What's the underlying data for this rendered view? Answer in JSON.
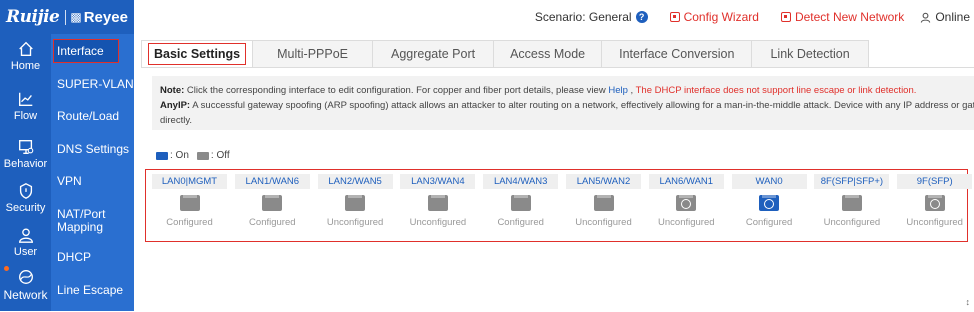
{
  "brand": {
    "name": "Ruijie",
    "product": "Reyee"
  },
  "header": {
    "scenario_label": "Scenario: General",
    "config_wizard": "Config Wizard",
    "detect_network": "Detect New Network",
    "online": "Online",
    "colors": {
      "primary": "#1e5fbd",
      "alert": "#e0302b"
    }
  },
  "rail": [
    {
      "label": "Home",
      "icon": "home-icon"
    },
    {
      "label": "Flow",
      "icon": "chart-icon"
    },
    {
      "label": "Behavior",
      "icon": "monitor-icon"
    },
    {
      "label": "Security",
      "icon": "shield-icon"
    },
    {
      "label": "User",
      "icon": "user-icon"
    },
    {
      "label": "Network",
      "icon": "globe-icon",
      "active": true
    }
  ],
  "submenu": [
    {
      "label": "Interface",
      "active": true
    },
    {
      "label": "SUPER-VLAN"
    },
    {
      "label": "Route/Load"
    },
    {
      "label": "DNS Settings"
    },
    {
      "label": "VPN"
    },
    {
      "label": "NAT/Port Mapping"
    },
    {
      "label": "DHCP"
    },
    {
      "label": "Line Escape"
    }
  ],
  "tabs": [
    {
      "label": "Basic Settings",
      "active": true
    },
    {
      "label": "Multi-PPPoE"
    },
    {
      "label": "Aggregate Port"
    },
    {
      "label": "Access Mode"
    },
    {
      "label": "Interface Conversion"
    },
    {
      "label": "Link Detection"
    }
  ],
  "note": {
    "note_label": "Note:",
    "note_text": "Click the corresponding interface to edit configuration. For copper and fiber port details, please view",
    "help_link": "Help",
    "note_warning": "The DHCP interface does not support line escape or link detection.",
    "anyip_label": "AnyIP:",
    "anyip_text": "A successful gateway spoofing (ARP spoofing) attack allows an attacker to alter routing on a network, effectively allowing for a man-in-the-middle attack. Device with any IP address or gateway ca",
    "anyip_text2": "directly."
  },
  "legend": {
    "on": ": On",
    "off": ": Off"
  },
  "ports": [
    {
      "name": "LAN0|MGMT",
      "status": "Configured",
      "state": "off",
      "kind": "copper"
    },
    {
      "name": "LAN1/WAN6",
      "status": "Configured",
      "state": "off",
      "kind": "copper"
    },
    {
      "name": "LAN2/WAN5",
      "status": "Unconfigured",
      "state": "off",
      "kind": "copper"
    },
    {
      "name": "LAN3/WAN4",
      "status": "Unconfigured",
      "state": "off",
      "kind": "copper"
    },
    {
      "name": "LAN4/WAN3",
      "status": "Configured",
      "state": "off",
      "kind": "copper"
    },
    {
      "name": "LAN5/WAN2",
      "status": "Unconfigured",
      "state": "off",
      "kind": "copper"
    },
    {
      "name": "LAN6/WAN1",
      "status": "Unconfigured",
      "state": "off",
      "kind": "sfp"
    },
    {
      "name": "WAN0",
      "status": "Configured",
      "state": "on",
      "kind": "sfp"
    },
    {
      "name": "8F(SFP|SFP+)",
      "status": "Unconfigured",
      "state": "off",
      "kind": "copper"
    },
    {
      "name": "9F(SFP)",
      "status": "Unconfigured",
      "state": "off",
      "kind": "sfp"
    }
  ],
  "port_colors": {
    "on": "#1e5fbd",
    "off": "#8a8a8a"
  }
}
